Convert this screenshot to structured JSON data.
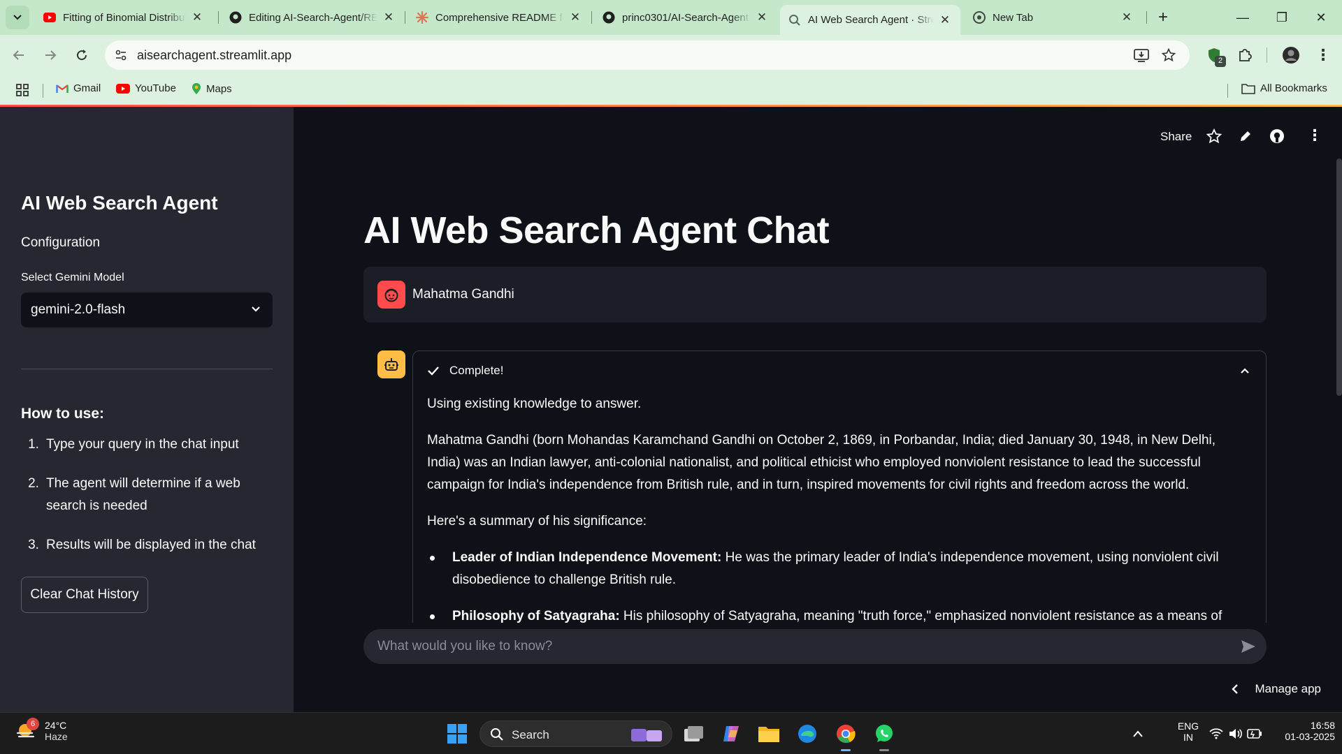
{
  "browser": {
    "tabs": [
      {
        "title": "Fitting of Binomial Distribution",
        "icon": "youtube-icon",
        "active": false
      },
      {
        "title": "Editing AI-Search-Agent/README",
        "icon": "github-icon",
        "active": false
      },
      {
        "title": "Comprehensive README for",
        "icon": "claude-icon",
        "active": false
      },
      {
        "title": "princ0301/AI-Search-Agent",
        "icon": "github-icon",
        "active": false
      },
      {
        "title": "AI Web Search Agent · Streamlit",
        "icon": "search-icon",
        "active": true
      },
      {
        "title": "New Tab",
        "icon": "chrome-icon",
        "active": false
      }
    ],
    "url": "aisearchagent.streamlit.app",
    "extension_badge": "2",
    "bookmarks": [
      {
        "label": "Gmail",
        "icon": "gmail-icon"
      },
      {
        "label": "YouTube",
        "icon": "youtube-icon"
      },
      {
        "label": "Maps",
        "icon": "maps-icon"
      }
    ],
    "all_bookmarks_label": "All Bookmarks",
    "colors": {
      "tab_bar": "#c4e8c9",
      "toolbar": "#ddf1e0"
    }
  },
  "app": {
    "header": {
      "share_label": "Share"
    },
    "sidebar": {
      "title": "AI Web Search Agent",
      "subtitle": "Configuration",
      "select_label": "Select Gemini Model",
      "selected_model": "gemini-2.0-flash",
      "howto_title": "How to use:",
      "steps": [
        {
          "num": "1.",
          "text": "Type your query in the chat input"
        },
        {
          "num": "2.",
          "text": "The agent will determine if a web search is needed"
        },
        {
          "num": "3.",
          "text": "Results will be displayed in the chat"
        }
      ],
      "clear_button": "Clear Chat History"
    },
    "main": {
      "title": "AI Web Search Agent Chat",
      "user_message": "Mahatma Gandhi",
      "status_label": "Complete!",
      "response": {
        "intro": "Using existing knowledge to answer.",
        "paragraph": "Mahatma Gandhi (born Mohandas Karamchand Gandhi on October 2, 1869, in Porbandar, India; died January 30, 1948, in New Delhi, India) was an Indian lawyer, anti-colonial nationalist, and political ethicist who employed nonviolent resistance to lead the successful campaign for India's independence from British rule, and in turn, inspired movements for civil rights and freedom across the world.",
        "summary_intro": "Here's a summary of his significance:",
        "bullets": [
          {
            "bold": "Leader of Indian Independence Movement:",
            "text": " He was the primary leader of India's independence movement, using nonviolent civil disobedience to challenge British rule."
          },
          {
            "bold": "Philosophy of Satyagraha:",
            "text": " His philosophy of Satyagraha, meaning \"truth force,\" emphasized nonviolent resistance as a means of"
          }
        ]
      },
      "chat_placeholder": "What would you like to know?",
      "manage_app": "Manage app"
    },
    "colors": {
      "sidebar_bg": "#262730",
      "main_bg": "#0e1117",
      "user_avatar": "#ff4b4b",
      "bot_avatar": "#ffbd45"
    }
  },
  "taskbar": {
    "weather": {
      "temp": "24°C",
      "condition": "Haze",
      "badge": "6"
    },
    "search_label": "Search",
    "language": "ENG",
    "region": "IN",
    "time": "16:58",
    "date": "01-03-2025"
  }
}
